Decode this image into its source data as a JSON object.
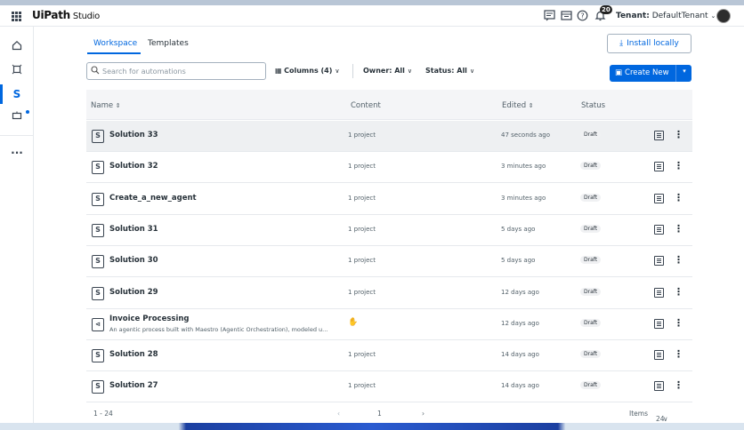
{
  "app": {
    "logo": "UiPath",
    "product": "Studio"
  },
  "header": {
    "notification_count": "20",
    "tenant_label": "Tenant:",
    "tenant_value": "DefaultTenant",
    "icons": [
      "apps-grid-icon",
      "feedback-icon",
      "learning-icon",
      "help-icon",
      "bell-icon"
    ]
  },
  "sidebar": {
    "items": [
      "home-icon",
      "process-icon",
      "studio-icon",
      "robot-icon",
      "more-icon"
    ]
  },
  "tabs": [
    {
      "label": "Workspace",
      "active": true
    },
    {
      "label": "Templates",
      "active": false
    }
  ],
  "actions": {
    "install": "Install locally",
    "create": "Create New"
  },
  "toolbar": {
    "search_placeholder": "Search for automations",
    "columns": "Columns (4)",
    "owner": "Owner: All",
    "status": "Status: All"
  },
  "table": {
    "headers": {
      "name": "Name",
      "content": "Content",
      "edited": "Edited",
      "status": "Status"
    },
    "sort_marker": "⇕",
    "rows": [
      {
        "name": "Solution 33",
        "description": "",
        "content": "1 project",
        "edited": "47 seconds ago",
        "status": "Draft"
      },
      {
        "name": "Solution 32",
        "description": "",
        "content": "1 project",
        "edited": "3 minutes ago",
        "status": "Draft"
      },
      {
        "name": "Create_a_new_agent",
        "description": "",
        "content": "1 project",
        "edited": "3 minutes ago",
        "status": "Draft"
      },
      {
        "name": "Solution 31",
        "description": "",
        "content": "1 project",
        "edited": "5 days ago",
        "status": "Draft"
      },
      {
        "name": "Solution 30",
        "description": "",
        "content": "1 project",
        "edited": "5 days ago",
        "status": "Draft"
      },
      {
        "name": "Solution 29",
        "description": "",
        "content": "1 project",
        "edited": "12 days ago",
        "status": "Draft"
      },
      {
        "name": "Invoice Processing",
        "description": "An agentic process built with Maestro (Agentic Orchestration), modeled u...",
        "content": "",
        "edited": "12 days ago",
        "status": "Draft"
      },
      {
        "name": "Solution 28",
        "description": "",
        "content": "1 project",
        "edited": "14 days ago",
        "status": "Draft"
      },
      {
        "name": "Solution 27",
        "description": "",
        "content": "1 project",
        "edited": "14 days ago",
        "status": "Draft"
      }
    ]
  },
  "pager": {
    "range": "1 - 24",
    "page": "1",
    "items_label": "Items",
    "items_value": "24"
  },
  "colors": {
    "accent": "#0067df",
    "text": "#273139",
    "muted": "#526069"
  }
}
